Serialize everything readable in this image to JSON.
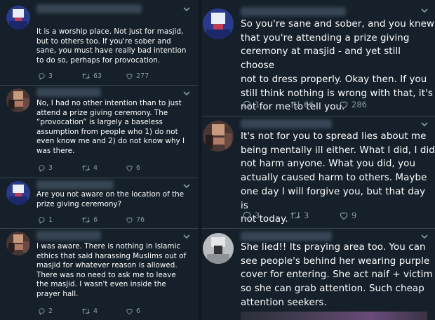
{
  "tweets_left": [
    {
      "text": "It is a worship place. Not just for masjid,\nbut to others too. If you're sober and\nsane, you must have really bad intention\nto do so, perhaps for provocation.",
      "replies": "3",
      "retweets": "63",
      "likes": "277"
    },
    {
      "text": "No, I had no other intention than to just\nattend a prize giving ceremony. The\n“provocation” is largely a baseless\nassumption from people who 1) do not\neven know me and 2) do not know why I\nwas there.",
      "replies": "3",
      "retweets": "4",
      "likes": "6"
    },
    {
      "text": "Are you not aware on the location of the\nprize giving ceremony?",
      "replies": "1",
      "retweets": "6",
      "likes": "76"
    },
    {
      "text": "I was aware. There is nothing in Islamic\nethics that said harassing Muslims out of\nmasjid for whatever reason is allowed.\nThere was no need to ask me to leave\nthe masjid. I wasn't even inside the\nprayer hall.",
      "replies": "2",
      "retweets": "4",
      "likes": "6"
    }
  ],
  "tweets_right": [
    {
      "text": "So you're sane and sober, and you knew\nthat you're attending a prize giving\nceremony at masjid - and yet still choose\nnot to dress properly. Okay then. If you\nstill think nothing is wrong with that, it's\nnot for me to tell you.",
      "replies": "1",
      "retweets": "66",
      "likes": "286"
    },
    {
      "text": "It's not for you to spread lies about me\nbeing mentally ill either. What I did, I did\nnot harm anyone. What you did, you\nactually caused harm to others. Maybe\none day I will forgive you, but that day is\nnot today.",
      "replies": "3",
      "retweets": "3",
      "likes": "9"
    },
    {
      "text": "She lied!! Its praying area too. You can\nsee people's behind her wearing purple\ncover for entering. She act naif + victim\nso she can grab attention. Such cheap\nattention seekers.",
      "replies": "",
      "retweets": "",
      "likes": ""
    }
  ],
  "colors": {
    "background": "#15202b",
    "divider": "#38444d",
    "text": "#ffffff",
    "muted": "#8899a6"
  },
  "icons": [
    "reply-icon",
    "retweet-icon",
    "like-icon",
    "chevron-down-icon"
  ]
}
